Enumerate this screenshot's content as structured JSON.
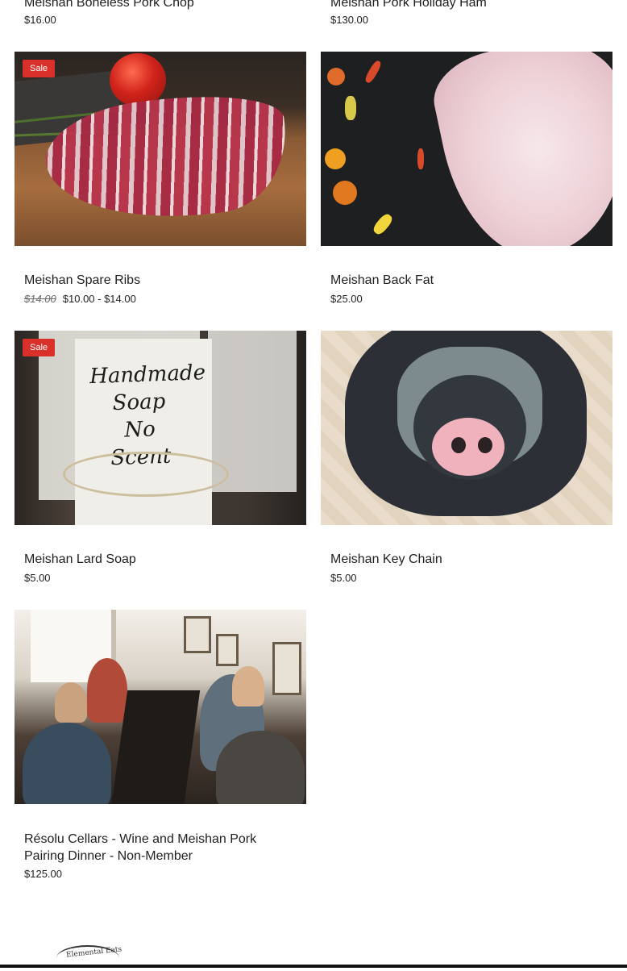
{
  "products": [
    {
      "title": "Meishan Boneless Pork Chop",
      "price": "$16.00"
    },
    {
      "title": "Meishan Pork Holiday Ham",
      "price": "$130.00"
    },
    {
      "title": "Meishan Spare Ribs",
      "old_price": "$14.00",
      "price": "$10.00 - $14.00",
      "badge": "Sale"
    },
    {
      "title": "Meishan Back Fat",
      "price": "$25.00"
    },
    {
      "title": "Meishan Lard Soap",
      "price": "$5.00",
      "badge": "Sale"
    },
    {
      "title": "Meishan Key Chain",
      "price": "$5.00"
    },
    {
      "title": "Résolu Cellars - Wine and Meishan Pork Pairing Dinner - Non-Member",
      "price": "$125.00"
    }
  ],
  "soap_image_text": [
    "Handmade",
    "Soap",
    "No Scent"
  ],
  "footer": {
    "logo_text": "Elemental Eats"
  },
  "colors": {
    "sale_badge": "#d9302b",
    "text": "#1f1f1f",
    "background": "#ffffff"
  }
}
